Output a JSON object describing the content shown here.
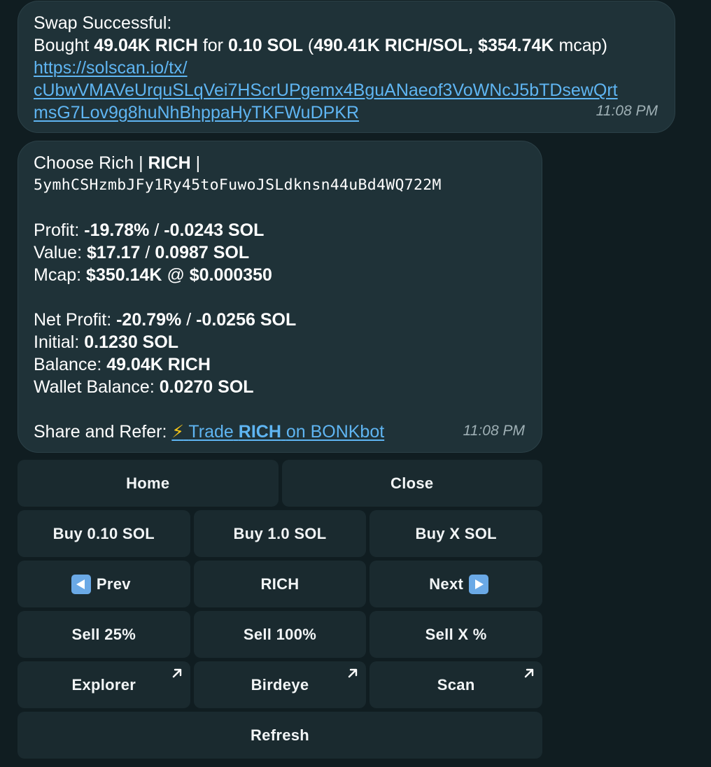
{
  "message1": {
    "title": "Swap Successful:",
    "bought_prefix": "Bought",
    "bought_amount": "49.04K RICH",
    "for_word": "for",
    "sol_amount": "0.10 SOL",
    "paren_open": "(",
    "rate": "490.41K RICH/SOL,",
    "mcap_value": "$354.74K",
    "mcap_suffix": "mcap)",
    "link_line1": "https://solscan.io/tx/",
    "link_line2": "cUbwVMAVeUrquSLqVei7HScrUPgemx4BguANaeof3VoWNcJ5bTDsewQrt",
    "link_line3": "msG7Lov9g8huNhBhppaHyTKFWuDPKR",
    "time": "11:08 PM"
  },
  "message2": {
    "token_name": "Choose Rich |",
    "token_symbol": "RICH",
    "pipe": "|",
    "address": "5ymhCSHzmbJFy1Ry45toFuwoJSLdknsn44uBd4WQ722M",
    "profit_label": "Profit:",
    "profit_pct": "-19.78%",
    "profit_sep": "/",
    "profit_sol": "-0.0243 SOL",
    "value_label": "Value:",
    "value_usd": "$17.17",
    "value_sep": "/",
    "value_sol": "0.0987 SOL",
    "mcap_label": "Mcap:",
    "mcap_value": "$350.14K",
    "mcap_at": "@",
    "mcap_price": "$0.000350",
    "net_label": "Net Profit:",
    "net_pct": "-20.79%",
    "net_sep": "/",
    "net_sol": "-0.0256 SOL",
    "initial_label": "Initial:",
    "initial_value": "0.1230 SOL",
    "balance_label": "Balance:",
    "balance_value": "49.04K RICH",
    "wallet_label": "Wallet Balance:",
    "wallet_value": "0.0270 SOL",
    "share_label": "Share and Refer:",
    "share_emoji": "⚡",
    "share_pre": "Trade",
    "share_token": "RICH",
    "share_post": "on BONKbot",
    "time": "11:08 PM"
  },
  "keyboard": {
    "home": "Home",
    "close": "Close",
    "buy_010": "Buy 0.10 SOL",
    "buy_10": "Buy 1.0 SOL",
    "buy_x": "Buy X SOL",
    "prev": "Prev",
    "token": "RICH",
    "next": "Next",
    "sell_25": "Sell 25%",
    "sell_100": "Sell 100%",
    "sell_x": "Sell X %",
    "explorer": "Explorer",
    "birdeye": "Birdeye",
    "scan": "Scan",
    "refresh": "Refresh"
  },
  "colors": {
    "background": "#101d21",
    "bubble": "#1f3238",
    "button": "#1a2a2f",
    "link": "#5fb5f2",
    "timestamp": "#9fb0b5"
  },
  "icons": {
    "external_link": "arrow-up-right-icon",
    "prev": "left-triangle-icon",
    "next": "right-triangle-icon",
    "lightning": "lightning-icon"
  }
}
